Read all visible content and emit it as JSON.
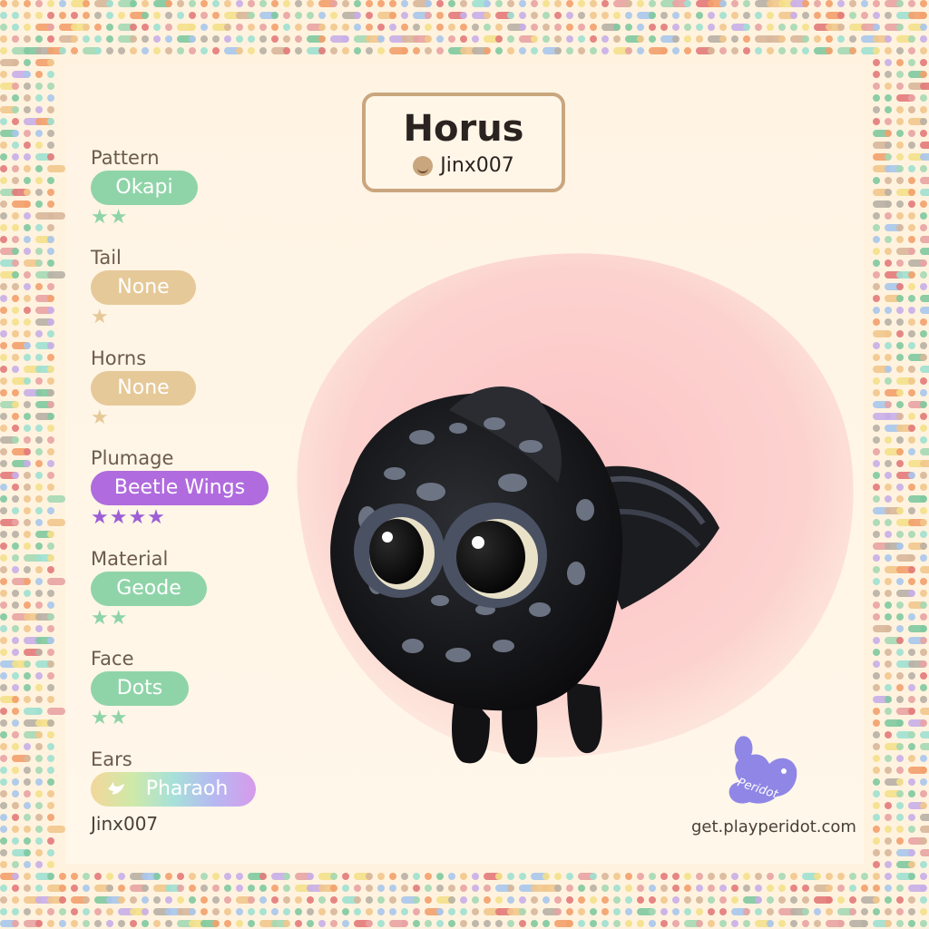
{
  "pet": {
    "name": "Horus",
    "owner": "Jinx007"
  },
  "traits": [
    {
      "label": "Pattern",
      "value": "Okapi",
      "stars": "★★",
      "tone": "green"
    },
    {
      "label": "Tail",
      "value": "None",
      "stars": "★",
      "tone": "tan"
    },
    {
      "label": "Horns",
      "value": "None",
      "stars": "★",
      "tone": "tan"
    },
    {
      "label": "Plumage",
      "value": "Beetle Wings",
      "stars": "★★★★",
      "tone": "purple"
    },
    {
      "label": "Material",
      "value": "Geode",
      "stars": "★★",
      "tone": "green"
    },
    {
      "label": "Face",
      "value": "Dots",
      "stars": "★★",
      "tone": "green"
    },
    {
      "label": "Ears",
      "value": "Pharaoh",
      "stars": "",
      "tone": "rainbow"
    }
  ],
  "footer": {
    "owner": "Jinx007",
    "site": "get.playperidot.com",
    "logo_text": "Peridot"
  },
  "colors": {
    "green": "#8fd4a8",
    "tan": "#e6c998",
    "purple": "#b06bde",
    "frame_border": "#c9a67e",
    "background": "#fff4e4",
    "blob": "#fbc9cb"
  },
  "icons": {
    "owner": "smiley-icon",
    "ears": "bird-icon",
    "logo": "peridot-bunny-icon"
  }
}
